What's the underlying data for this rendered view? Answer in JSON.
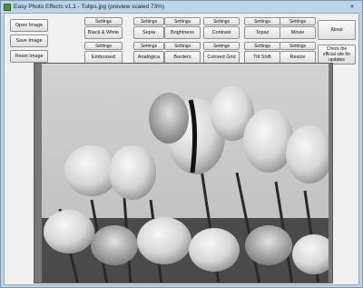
{
  "window": {
    "title": "Easy Photo Effects v1.1 - Tulips.jpg (preview scaled 73%)",
    "close_glyph": "✕"
  },
  "side_buttons": {
    "open": "Open Image",
    "save": "Save Image",
    "reset": "Reset Image"
  },
  "effects_row1": [
    {
      "settings": "Settings",
      "label": "Black & White"
    },
    {
      "settings": "Settings",
      "label": "Sepia"
    },
    {
      "settings": "Settings",
      "label": "Brightness"
    },
    {
      "settings": "Settings",
      "label": "Contrast"
    },
    {
      "settings": "Settings",
      "label": "Topaz"
    },
    {
      "settings": "Settings",
      "label": "Movie"
    }
  ],
  "effects_row2": [
    {
      "settings": "Settings",
      "label": "Embossed"
    },
    {
      "settings": "Settings",
      "label": "Analogica"
    },
    {
      "settings": "Settings",
      "label": "Borders"
    },
    {
      "settings": "Settings",
      "label": "Colored Grid"
    },
    {
      "settings": "Settings",
      "label": "Tilt Shift"
    },
    {
      "settings": "Settings",
      "label": "Resize"
    }
  ],
  "right_buttons": {
    "about": "About",
    "check": "Check the official site for updates"
  },
  "colors": {
    "window_frame": "#bcd4ea",
    "client_bg": "#f0f0f0",
    "preview_bg": "#777777"
  }
}
